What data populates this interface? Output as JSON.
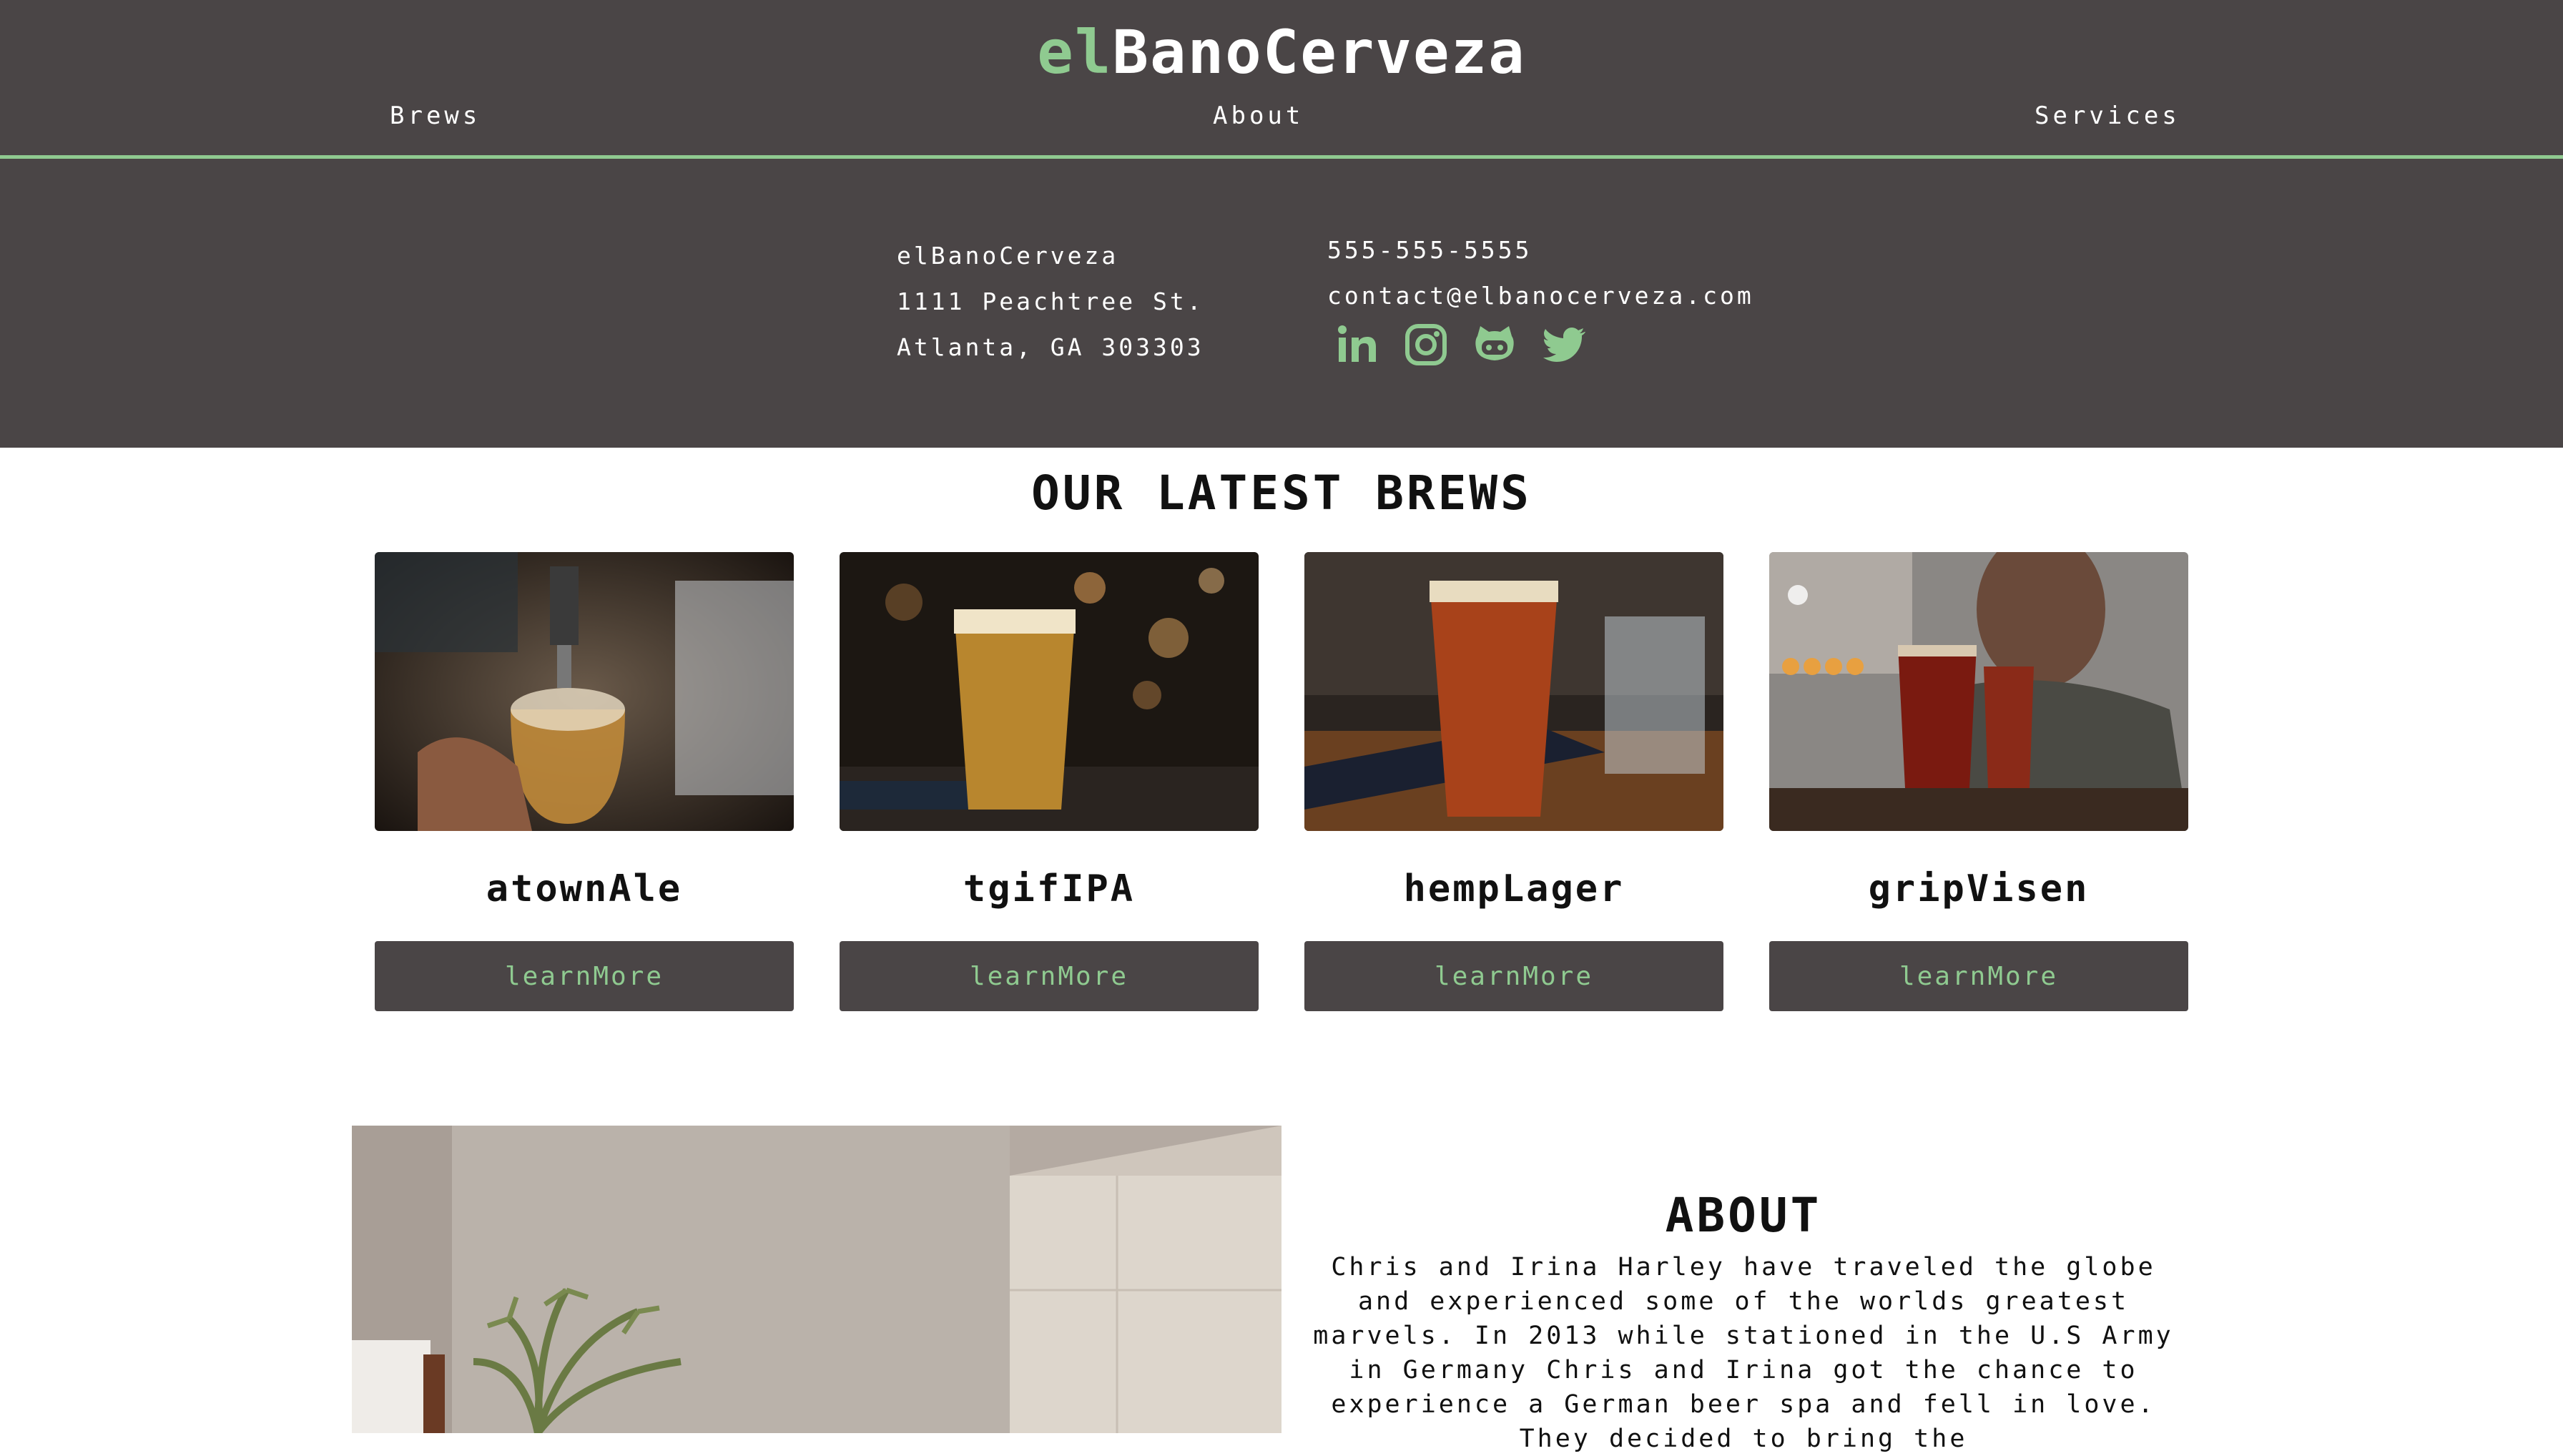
{
  "header": {
    "logo_prefix": "el",
    "logo_rest": "BanoCerveza",
    "nav": [
      {
        "label": "Brews"
      },
      {
        "label": "About"
      },
      {
        "label": "Services"
      }
    ]
  },
  "contact": {
    "address": [
      "elBanoCerveza",
      "1111 Peachtree St.",
      "Atlanta, GA 303303"
    ],
    "phone": "555-555-5555",
    "email": "contact@elbanocerveza.com",
    "social": [
      "linkedin-icon",
      "instagram-icon",
      "github-icon",
      "twitter-icon"
    ]
  },
  "brews": {
    "title": "OUR LATEST BREWS",
    "cards": [
      {
        "name": "atownAle",
        "button": "learnMore"
      },
      {
        "name": "tgifIPA",
        "button": "learnMore"
      },
      {
        "name": "hempLager",
        "button": "learnMore"
      },
      {
        "name": "gripVisen",
        "button": "learnMore"
      }
    ]
  },
  "about": {
    "title": "ABOUT",
    "text": "Chris and Irina Harley have traveled the globe and experienced some of the worlds greatest marvels. In 2013 while stationed in the U.S Army in Germany Chris and Irina got the chance to experience a German beer spa and fell in love. They decided to bring the"
  },
  "colors": {
    "dark": "#4a4546",
    "accent": "#8fca90"
  }
}
